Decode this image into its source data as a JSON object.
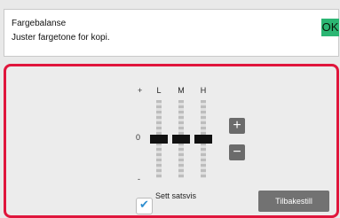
{
  "header": {
    "title": "Fargebalanse",
    "subtitle": "Juster fargetone for kopi.",
    "ok_label": "OK"
  },
  "scale": {
    "plus": "+",
    "zero": "0",
    "minus": "-"
  },
  "sliders": [
    {
      "label": "L",
      "value": 0
    },
    {
      "label": "M",
      "value": 0
    },
    {
      "label": "H",
      "value": 0
    }
  ],
  "buttons": {
    "increase_label": "+",
    "decrease_label": "−",
    "reset_label": "Tilbakestill"
  },
  "batch": {
    "label": "Sett satsvis",
    "checked": true
  },
  "colors": {
    "accent_green": "#2bb673",
    "highlight_red": "#e0163c",
    "check_blue": "#2e8fd0"
  }
}
